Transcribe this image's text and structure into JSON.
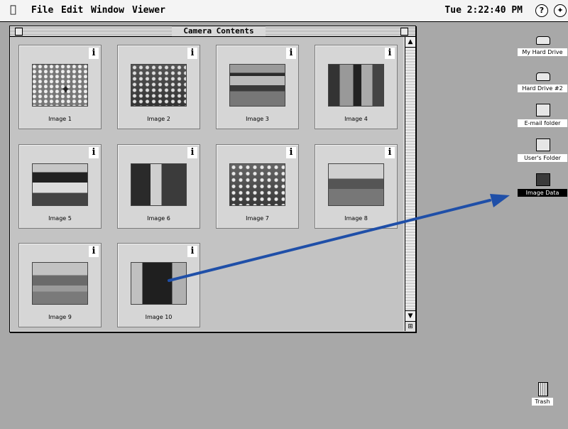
{
  "menubar": {
    "apple_glyph": "",
    "menus": [
      "File",
      "Edit",
      "Window",
      "Viewer"
    ],
    "clock": "Tue 2:22:40 PM",
    "help_icon": "help-icon",
    "app_icon": "application-switcher-icon"
  },
  "window": {
    "title": "Camera Contents",
    "tiles": [
      {
        "label": "Image 1",
        "info": "i"
      },
      {
        "label": "Image 2",
        "info": "i"
      },
      {
        "label": "Image 3",
        "info": "i"
      },
      {
        "label": "Image 4",
        "info": "i"
      },
      {
        "label": "Image 5",
        "info": "i"
      },
      {
        "label": "Image 6",
        "info": "i"
      },
      {
        "label": "Image 7",
        "info": "i"
      },
      {
        "label": "Image 8",
        "info": "i"
      },
      {
        "label": "Image 9",
        "info": "i"
      },
      {
        "label": "Image 10",
        "info": "i"
      }
    ]
  },
  "desktop": {
    "icons": [
      {
        "label": "My Hard Drive",
        "kind": "hard-drive-icon"
      },
      {
        "label": "Hard Drive #2",
        "kind": "hard-drive-icon"
      },
      {
        "label": "E-mail folder",
        "kind": "folder-icon"
      },
      {
        "label": "User's Folder",
        "kind": "folder-icon"
      },
      {
        "label": "Image Data",
        "kind": "folder-icon",
        "selected": true
      }
    ],
    "trash": {
      "label": "Trash",
      "kind": "trash-icon"
    }
  },
  "colors": {
    "desktop": "#a8a8a8",
    "window_content": "#c3c3c3",
    "drag_arrow": "#1f4fa8"
  }
}
